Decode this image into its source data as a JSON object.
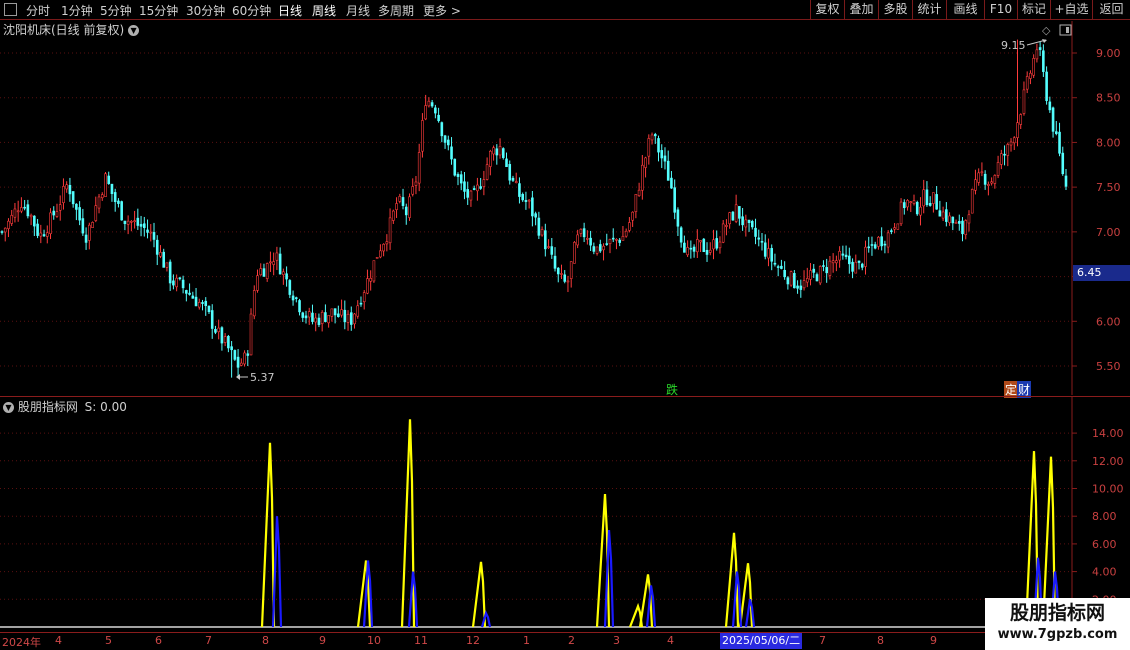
{
  "toolbar": {
    "tabs": [
      "分时",
      "1分钟",
      "5分钟",
      "15分钟",
      "30分钟",
      "60分钟",
      "日线",
      "周线",
      "月线",
      "多周期",
      "更多 >"
    ],
    "active_tab": "日线",
    "right_buttons": [
      "复权",
      "叠加",
      "多股",
      "统计",
      "画线",
      "F10",
      "标记",
      "+自选",
      "返回"
    ]
  },
  "main_panel": {
    "title": "沈阳机床(日线 前复权)",
    "current_price_tag": "6.45",
    "high_annotation": "9.15",
    "low_annotation": "5.37",
    "axis_labels": [
      "9.00",
      "8.50",
      "8.00",
      "7.50",
      "7.00",
      "6.00",
      "5.50"
    ],
    "event_tags": {
      "die": "跌",
      "ding": "定",
      "cai": "财"
    }
  },
  "indicator_panel": {
    "title": "股朋指标网",
    "value_label": "S: 0.00",
    "axis_labels": [
      "14.00",
      "12.00",
      "10.00",
      "8.00",
      "6.00",
      "4.00",
      "2.00"
    ]
  },
  "date_axis": {
    "labels": [
      "2024年",
      "4",
      "5",
      "6",
      "7",
      "8",
      "9",
      "10",
      "11",
      "12",
      "1",
      "2",
      "3",
      "4",
      "7",
      "8",
      "9"
    ],
    "highlight": "2025/05/06/二"
  },
  "watermark": {
    "name": "股朋指标网",
    "url": "www.7gpzb.com"
  },
  "chart_data": [
    {
      "type": "candlestick",
      "title": "沈阳机床(日线 前复权)",
      "yticks": [
        5.5,
        6.0,
        6.5,
        7.0,
        7.5,
        8.0,
        8.5,
        9.0
      ],
      "ylim": [
        5.25,
        9.4
      ],
      "annotations": {
        "high": 9.15,
        "low": 5.37,
        "last": 6.45
      },
      "close_path": [
        7.0,
        7.15,
        7.35,
        7.2,
        6.95,
        7.1,
        7.3,
        7.55,
        7.2,
        6.95,
        7.3,
        7.6,
        7.35,
        7.15,
        7.1,
        7.05,
        6.95,
        6.7,
        6.45,
        6.4,
        6.3,
        6.2,
        6.05,
        5.85,
        5.7,
        5.5,
        5.6,
        6.55,
        6.6,
        6.75,
        6.5,
        6.3,
        6.1,
        6.0,
        6.05,
        6.1,
        6.05,
        6.0,
        6.25,
        6.5,
        6.8,
        7.0,
        7.35,
        7.2,
        7.6,
        8.5,
        8.4,
        8.05,
        7.7,
        7.45,
        7.35,
        7.6,
        7.9,
        7.95,
        7.6,
        7.4,
        7.3,
        7.05,
        6.8,
        6.5,
        6.4,
        6.9,
        7.0,
        6.8,
        6.85,
        6.9,
        6.95,
        7.2,
        7.7,
        8.1,
        7.85,
        7.55,
        7.0,
        6.7,
        6.85,
        6.8,
        6.9,
        7.1,
        7.25,
        7.05,
        6.95,
        6.8,
        6.65,
        6.55,
        6.45,
        6.4,
        6.5,
        6.55,
        6.65,
        6.7,
        6.65,
        6.6,
        6.8,
        6.9,
        6.95,
        7.15,
        7.35,
        7.25,
        7.4,
        7.35,
        7.2,
        7.1,
        7.0,
        7.4,
        7.65,
        7.55,
        7.8,
        7.95,
        8.3,
        8.7,
        9.1,
        8.5,
        8.0,
        7.5
      ]
    },
    {
      "type": "line",
      "title": "股朋指标网",
      "yticks": [
        2,
        4,
        6,
        8,
        10,
        12,
        14
      ],
      "ylim": [
        0,
        15.5
      ],
      "series": [
        {
          "color": "#ffff00",
          "peaks": [
            [
              270,
              13.3
            ],
            [
              366,
              4.8
            ],
            [
              410,
              15.0
            ],
            [
              481,
              4.7
            ],
            [
              605,
              9.6
            ],
            [
              638,
              1.5
            ],
            [
              648,
              3.8
            ],
            [
              734,
              6.8
            ],
            [
              748,
              4.6
            ],
            [
              1034,
              12.7
            ],
            [
              1051,
              12.3
            ]
          ]
        },
        {
          "color": "#1a1aff",
          "peaks": [
            [
              277,
              8.0
            ],
            [
              368,
              4.8
            ],
            [
              413,
              4.0
            ],
            [
              486,
              1.0
            ],
            [
              609,
              7.0
            ],
            [
              651,
              3.0
            ],
            [
              737,
              4.0
            ],
            [
              750,
              2.0
            ],
            [
              1038,
              5.0
            ],
            [
              1055,
              4.0
            ]
          ]
        }
      ]
    }
  ]
}
